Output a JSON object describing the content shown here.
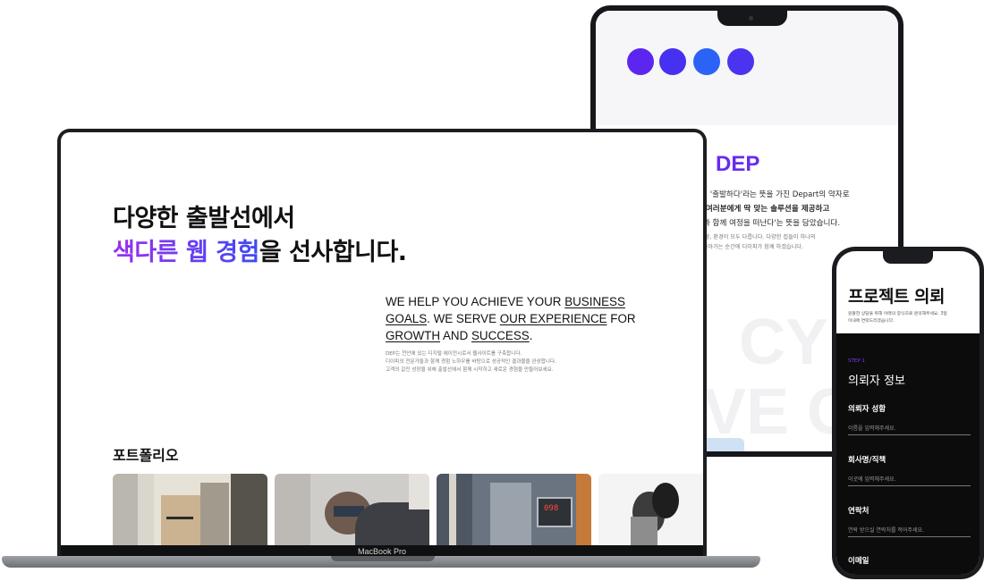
{
  "tablet": {
    "dots": [
      "#5b27f0",
      "#4630f2",
      "#2a63f6",
      "#4a34f0"
    ],
    "title": "DEP",
    "lines": [
      "다', '출발하다'라는 뜻을 가진 Depart의 약자로",
      "는 여러분에게 딱 맞는 솔루션을 제공하고",
      "객과 함께 여정을 떠난다'는 뜻을 담았습니다.",
      ", 상황, 환경이 모두 다릅니다. 다양한 접들이 하나의",
      "고 나아가는 순간에 디이피가 함께 하겠습니다."
    ],
    "bg_word_1": "CY",
    "bg_word_2": "VE C"
  },
  "laptop": {
    "brand_label": "MacBook Pro",
    "hero": {
      "line1": "다양한 출발선에서",
      "line2_accent": "색다른 웹 경험",
      "line2_rest": "을 선사합니다."
    },
    "tagline": {
      "t1": "WE HELP YOU ACHIEVE YOUR ",
      "u1": "BUSINESS GOALS",
      "t2": ".  WE SERVE ",
      "u2": "OUR EXPERIENCE",
      "t3": " FOR ",
      "u3": "GROWTH",
      "t4": " AND ",
      "u4": "SUCCESS",
      "t5": "."
    },
    "description": [
      "DEP는 천안에 있는 디지털 에이전시로서 웹사이트를 구축합니다.",
      "디이피의 전문가들과 함께 경험 노하우를 바탕으로 성공적인 결과물을 완성합니다.",
      "고객의 값진 성장을 위해 출발선에서 함께 시작하고 새로운 경험을 만들어보세요."
    ],
    "portfolio_heading": "포트폴리오",
    "portfolio_counter": "098"
  },
  "phone": {
    "title": "프로젝트 의뢰",
    "subtitle_lines": [
      "원활한 상담을 위해 아래의 양식으로 문의해주세요. 3일",
      "이내에 연락드리겠습니다."
    ],
    "step_label": "STEP 1",
    "section_title": "의뢰자 정보",
    "fields": [
      {
        "label": "의뢰자 성함",
        "placeholder": "이름을 입력해주세요."
      },
      {
        "label": "회사명/직책",
        "placeholder": "이곳에 입력해주세요."
      },
      {
        "label": "연락처",
        "placeholder": "연락 받으실 연락처를 적어주세요."
      },
      {
        "label": "이메일",
        "placeholder": ""
      }
    ]
  }
}
